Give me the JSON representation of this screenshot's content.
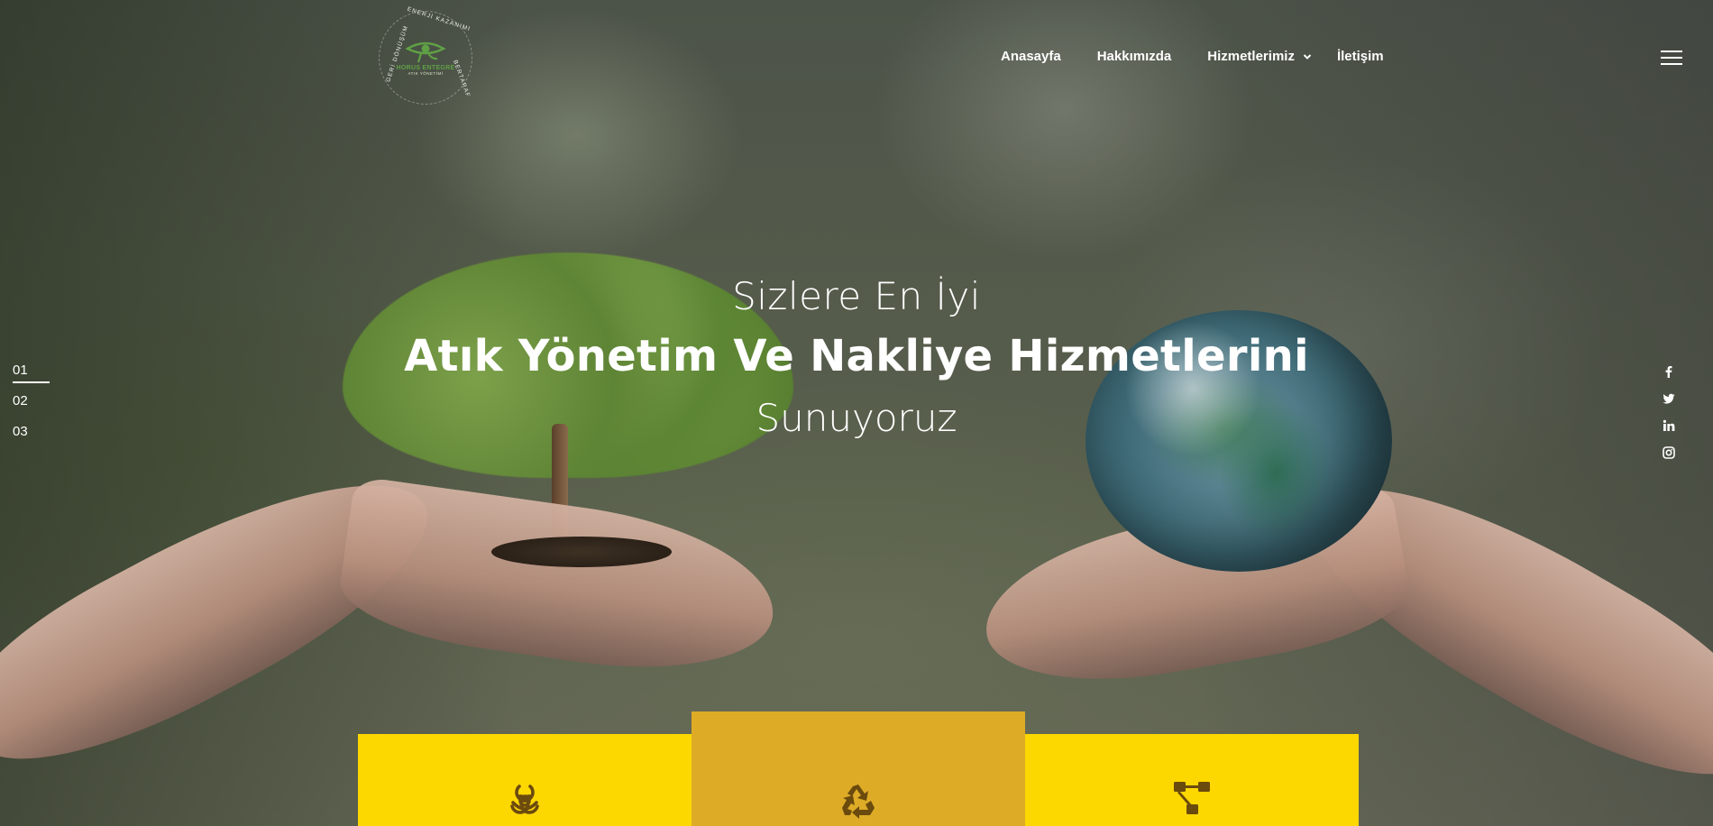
{
  "logo": {
    "name": "HORUS ENTEGRE",
    "subtitle": "ATIK YÖNETİMİ",
    "ring_top": "ENERJİ KAZANIMI",
    "ring_left": "GERİ DÖNÜŞÜM",
    "ring_right": "BERTARAF"
  },
  "nav": {
    "items": [
      {
        "label": "Anasayfa"
      },
      {
        "label": "Hakkımızda"
      },
      {
        "label": "Hizmetlerimiz"
      },
      {
        "label": "İletişim"
      }
    ],
    "menu_icon": "hamburger-icon"
  },
  "slider": {
    "slides": [
      "01",
      "02",
      "03"
    ],
    "active": "01"
  },
  "hero": {
    "line1": "Sizlere En İyi",
    "line2": "Atık Yönetim Ve Nakliye Hizmetlerini",
    "line3": "Sunuyoruz"
  },
  "social": [
    "facebook-icon",
    "twitter-icon",
    "linkedin-icon",
    "instagram-icon"
  ],
  "cards": [
    {
      "icon": "biohazard-icon",
      "color": "#fdd700"
    },
    {
      "icon": "recycle-icon",
      "color": "#ddab26"
    },
    {
      "icon": "sitemap-icon",
      "color": "#fdd700"
    }
  ],
  "colors": {
    "accent_yellow": "#fdd700",
    "accent_gold": "#ddab26",
    "icon_color": "#6b4a0e",
    "logo_green": "#5fa046"
  }
}
